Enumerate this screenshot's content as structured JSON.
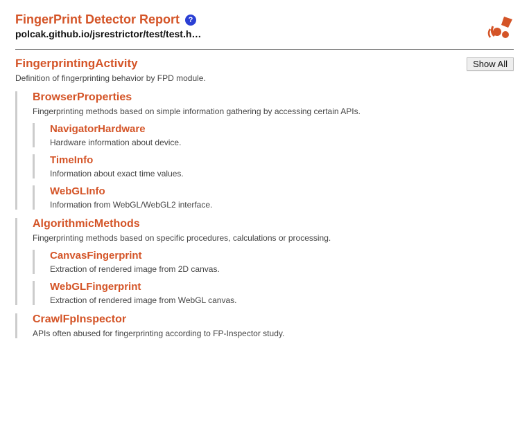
{
  "header": {
    "title": "FingerPrint Detector Report",
    "help": "?",
    "domain": "polcak.github.io/jsrestrictor/test/test.h…"
  },
  "section": {
    "title": "FingerprintingActivity",
    "show_all": "Show All",
    "desc": "Definition of fingerprinting behavior by FPD module."
  },
  "groups": [
    {
      "title": "BrowserProperties",
      "desc": "Fingerprinting methods based on simple information gathering by accessing certain APIs.",
      "subs": [
        {
          "title": "NavigatorHardware",
          "desc": "Hardware information about device."
        },
        {
          "title": "TimeInfo",
          "desc": "Information about exact time values."
        },
        {
          "title": "WebGLInfo",
          "desc": "Information from WebGL/WebGL2 interface."
        }
      ]
    },
    {
      "title": "AlgorithmicMethods",
      "desc": "Fingerprinting methods based on specific procedures, calculations or processing.",
      "subs": [
        {
          "title": "CanvasFingerprint",
          "desc": "Extraction of rendered image from 2D canvas."
        },
        {
          "title": "WebGLFingerprint",
          "desc": "Extraction of rendered image from WebGL canvas."
        }
      ]
    },
    {
      "title": "CrawlFpInspector",
      "desc": "APIs often abused for fingerprinting according to FP-Inspector study.",
      "subs": []
    }
  ]
}
